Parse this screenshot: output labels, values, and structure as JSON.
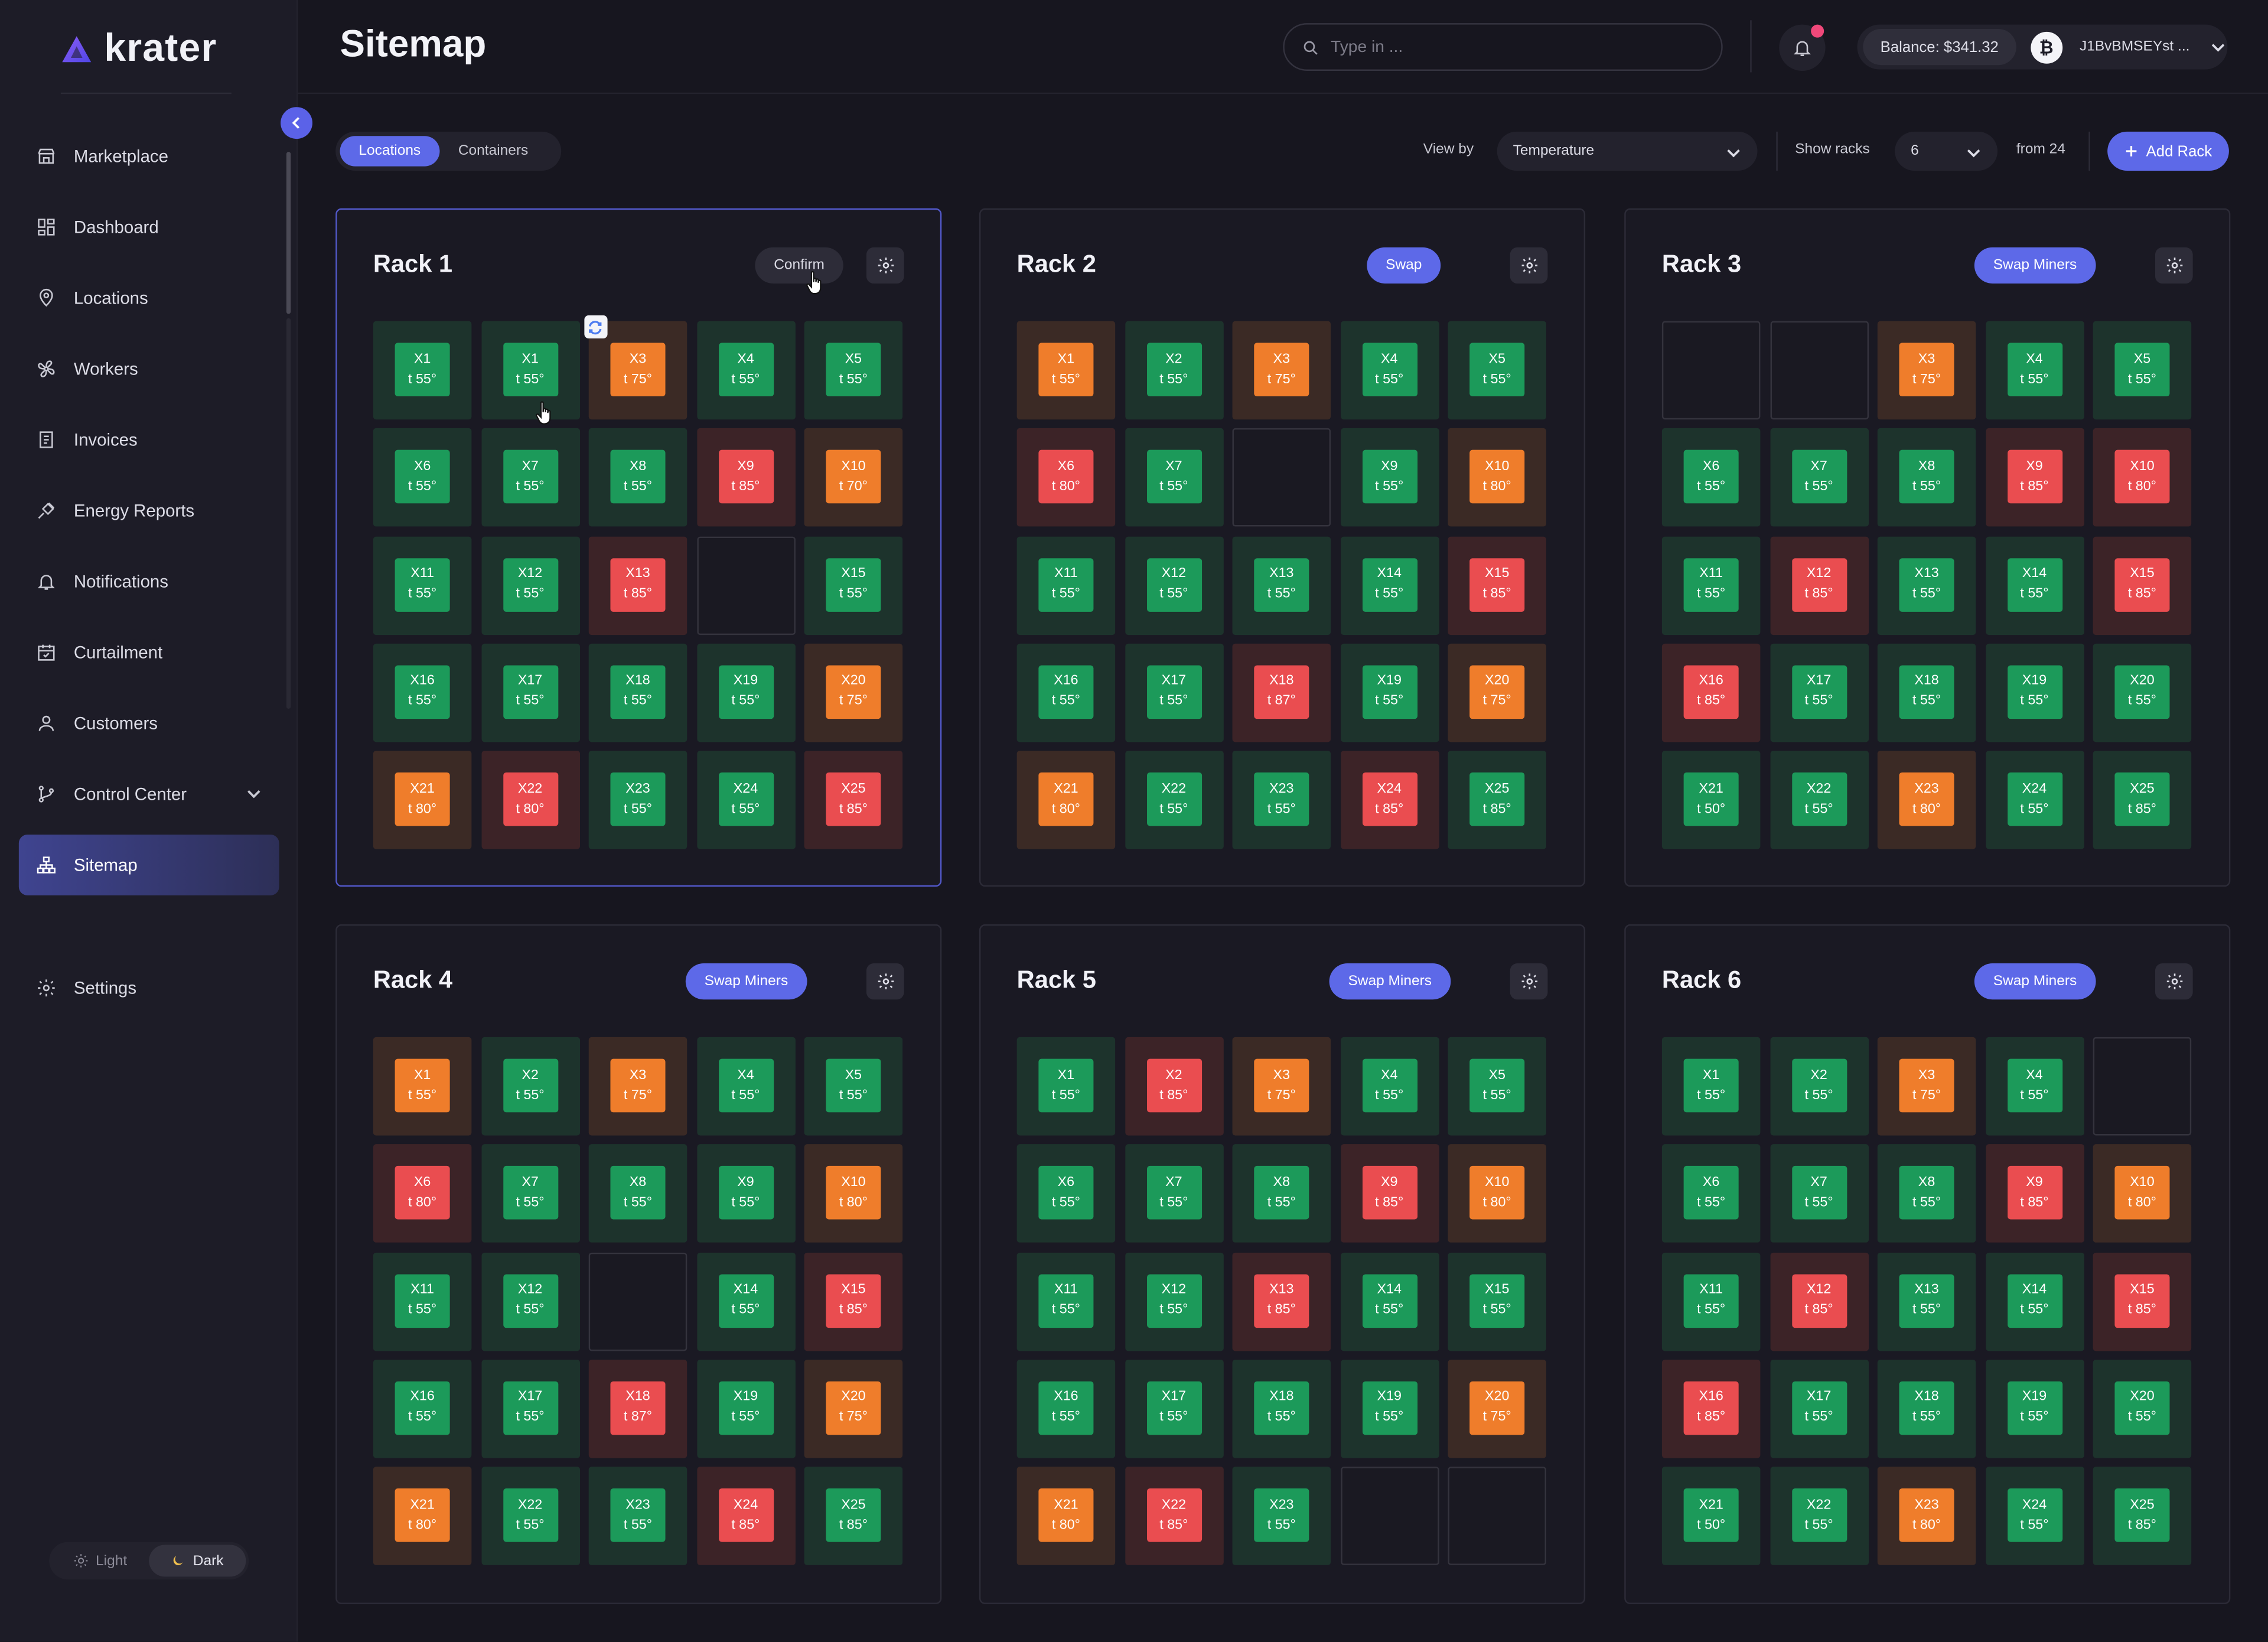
{
  "app": {
    "name": "krater"
  },
  "sidebar": {
    "items": [
      {
        "label": "Marketplace",
        "icon": "storefront-icon"
      },
      {
        "label": "Dashboard",
        "icon": "dashboard-grid-icon"
      },
      {
        "label": "Locations",
        "icon": "map-pin-icon"
      },
      {
        "label": "Workers",
        "icon": "fan-icon"
      },
      {
        "label": "Invoices",
        "icon": "invoice-icon"
      },
      {
        "label": "Energy Reports",
        "icon": "plug-icon"
      },
      {
        "label": "Notifications",
        "icon": "bell-icon"
      },
      {
        "label": "Curtailment",
        "icon": "calendar-check-icon"
      },
      {
        "label": "Customers",
        "icon": "user-icon"
      },
      {
        "label": "Control Center",
        "icon": "git-branch-icon"
      },
      {
        "label": "Sitemap",
        "icon": "sitemap-icon",
        "active": true
      }
    ],
    "settings": {
      "label": "Settings",
      "icon": "gear-icon"
    },
    "theme": {
      "light": "Light",
      "dark": "Dark",
      "selected": "Dark"
    }
  },
  "header": {
    "title": "Sitemap",
    "search_placeholder": "Type in ...",
    "balance": "Balance: $341.32",
    "wallet": "J1BvBMSEYst ...",
    "notification_dot_color": "#f0487a"
  },
  "toolbar": {
    "tabs": [
      "Locations",
      "Containers"
    ],
    "active_tab": "Locations",
    "view_by_label": "View by",
    "view_by_value": "Temperature",
    "show_racks_label": "Show racks",
    "show_racks_value": "6",
    "from_label": "from 24",
    "add_rack": "Add Rack"
  },
  "colors": {
    "accent": "#5d69e8",
    "ok_green": "#1c9a5a",
    "warn_orange": "#ef7d2b",
    "hot_red": "#ea4d50"
  },
  "racks": [
    {
      "name": "Rack 1",
      "action": "Confirm",
      "action_style": "confirm",
      "cells": [
        [
          "X1",
          "t 55°",
          "g"
        ],
        [
          "X1",
          "t 55°",
          "g"
        ],
        [
          "X3",
          "t 75°",
          "o"
        ],
        [
          "X4",
          "t 55°",
          "g"
        ],
        [
          "X5",
          "t 55°",
          "g"
        ],
        [
          "X6",
          "t 55°",
          "g"
        ],
        [
          "X7",
          "t 55°",
          "g"
        ],
        [
          "X8",
          "t 55°",
          "g"
        ],
        [
          "X9",
          "t 85°",
          "r"
        ],
        [
          "X10",
          "t 70°",
          "o"
        ],
        [
          "X11",
          "t 55°",
          "g"
        ],
        [
          "X12",
          "t 55°",
          "g"
        ],
        [
          "X13",
          "t 85°",
          "r"
        ],
        null,
        [
          "X15",
          "t 55°",
          "g"
        ],
        [
          "X16",
          "t 55°",
          "g"
        ],
        [
          "X17",
          "t 55°",
          "g"
        ],
        [
          "X18",
          "t 55°",
          "g"
        ],
        [
          "X19",
          "t 55°",
          "g"
        ],
        [
          "X20",
          "t 75°",
          "o"
        ],
        [
          "X21",
          "t 80°",
          "o"
        ],
        [
          "X22",
          "t 80°",
          "r"
        ],
        [
          "X23",
          "t 55°",
          "g"
        ],
        [
          "X24",
          "t 55°",
          "g"
        ],
        [
          "X25",
          "t 85°",
          "r"
        ]
      ]
    },
    {
      "name": "Rack 2",
      "action": "Swap",
      "action_style": "primary",
      "cells": [
        [
          "X1",
          "t 55°",
          "o"
        ],
        [
          "X2",
          "t 55°",
          "g"
        ],
        [
          "X3",
          "t 75°",
          "o"
        ],
        [
          "X4",
          "t 55°",
          "g"
        ],
        [
          "X5",
          "t 55°",
          "g"
        ],
        [
          "X6",
          "t 80°",
          "r"
        ],
        [
          "X7",
          "t 55°",
          "g"
        ],
        null,
        [
          "X9",
          "t 55°",
          "g"
        ],
        [
          "X10",
          "t 80°",
          "o"
        ],
        [
          "X11",
          "t 55°",
          "g"
        ],
        [
          "X12",
          "t 55°",
          "g"
        ],
        [
          "X13",
          "t 55°",
          "g"
        ],
        [
          "X14",
          "t 55°",
          "g"
        ],
        [
          "X15",
          "t 85°",
          "r"
        ],
        [
          "X16",
          "t 55°",
          "g"
        ],
        [
          "X17",
          "t 55°",
          "g"
        ],
        [
          "X18",
          "t 87°",
          "r"
        ],
        [
          "X19",
          "t 55°",
          "g"
        ],
        [
          "X20",
          "t 75°",
          "o"
        ],
        [
          "X21",
          "t 80°",
          "o"
        ],
        [
          "X22",
          "t 55°",
          "g"
        ],
        [
          "X23",
          "t 55°",
          "g"
        ],
        [
          "X24",
          "t 85°",
          "r"
        ],
        [
          "X25",
          "t 85°",
          "g"
        ]
      ]
    },
    {
      "name": "Rack 3",
      "action": "Swap Miners",
      "action_style": "primary",
      "cells": [
        null,
        null,
        [
          "X3",
          "t 75°",
          "o"
        ],
        [
          "X4",
          "t 55°",
          "g"
        ],
        [
          "X5",
          "t 55°",
          "g"
        ],
        [
          "X6",
          "t 55°",
          "g"
        ],
        [
          "X7",
          "t 55°",
          "g"
        ],
        [
          "X8",
          "t 55°",
          "g"
        ],
        [
          "X9",
          "t 85°",
          "r"
        ],
        [
          "X10",
          "t 80°",
          "r"
        ],
        [
          "X11",
          "t 55°",
          "g"
        ],
        [
          "X12",
          "t 85°",
          "r"
        ],
        [
          "X13",
          "t 55°",
          "g"
        ],
        [
          "X14",
          "t 55°",
          "g"
        ],
        [
          "X15",
          "t 85°",
          "r"
        ],
        [
          "X16",
          "t 85°",
          "r"
        ],
        [
          "X17",
          "t 55°",
          "g"
        ],
        [
          "X18",
          "t 55°",
          "g"
        ],
        [
          "X19",
          "t 55°",
          "g"
        ],
        [
          "X20",
          "t 55°",
          "g"
        ],
        [
          "X21",
          "t 50°",
          "g"
        ],
        [
          "X22",
          "t 55°",
          "g"
        ],
        [
          "X23",
          "t 80°",
          "o"
        ],
        [
          "X24",
          "t 55°",
          "g"
        ],
        [
          "X25",
          "t 85°",
          "g"
        ]
      ]
    },
    {
      "name": "Rack 4",
      "action": "Swap Miners",
      "action_style": "primary",
      "cells": [
        [
          "X1",
          "t 55°",
          "o"
        ],
        [
          "X2",
          "t 55°",
          "g"
        ],
        [
          "X3",
          "t 75°",
          "o"
        ],
        [
          "X4",
          "t 55°",
          "g"
        ],
        [
          "X5",
          "t 55°",
          "g"
        ],
        [
          "X6",
          "t 80°",
          "r"
        ],
        [
          "X7",
          "t 55°",
          "g"
        ],
        [
          "X8",
          "t 55°",
          "g"
        ],
        [
          "X9",
          "t 55°",
          "g"
        ],
        [
          "X10",
          "t 80°",
          "o"
        ],
        [
          "X11",
          "t 55°",
          "g"
        ],
        [
          "X12",
          "t 55°",
          "g"
        ],
        null,
        [
          "X14",
          "t 55°",
          "g"
        ],
        [
          "X15",
          "t 85°",
          "r"
        ],
        [
          "X16",
          "t 55°",
          "g"
        ],
        [
          "X17",
          "t 55°",
          "g"
        ],
        [
          "X18",
          "t 87°",
          "r"
        ],
        [
          "X19",
          "t 55°",
          "g"
        ],
        [
          "X20",
          "t 75°",
          "o"
        ],
        [
          "X21",
          "t 80°",
          "o"
        ],
        [
          "X22",
          "t 55°",
          "g"
        ],
        [
          "X23",
          "t 55°",
          "g"
        ],
        [
          "X24",
          "t 85°",
          "r"
        ],
        [
          "X25",
          "t 85°",
          "g"
        ]
      ]
    },
    {
      "name": "Rack 5",
      "action": "Swap Miners",
      "action_style": "primary",
      "cells": [
        [
          "X1",
          "t 55°",
          "g"
        ],
        [
          "X2",
          "t 85°",
          "r"
        ],
        [
          "X3",
          "t 75°",
          "o"
        ],
        [
          "X4",
          "t 55°",
          "g"
        ],
        [
          "X5",
          "t 55°",
          "g"
        ],
        [
          "X6",
          "t 55°",
          "g"
        ],
        [
          "X7",
          "t 55°",
          "g"
        ],
        [
          "X8",
          "t 55°",
          "g"
        ],
        [
          "X9",
          "t 85°",
          "r"
        ],
        [
          "X10",
          "t 80°",
          "o"
        ],
        [
          "X11",
          "t 55°",
          "g"
        ],
        [
          "X12",
          "t 55°",
          "g"
        ],
        [
          "X13",
          "t 85°",
          "r"
        ],
        [
          "X14",
          "t 55°",
          "g"
        ],
        [
          "X15",
          "t 55°",
          "g"
        ],
        [
          "X16",
          "t 55°",
          "g"
        ],
        [
          "X17",
          "t 55°",
          "g"
        ],
        [
          "X18",
          "t 55°",
          "g"
        ],
        [
          "X19",
          "t 55°",
          "g"
        ],
        [
          "X20",
          "t 75°",
          "o"
        ],
        [
          "X21",
          "t 80°",
          "o"
        ],
        [
          "X22",
          "t 85°",
          "r"
        ],
        [
          "X23",
          "t 55°",
          "g"
        ],
        null,
        null
      ]
    },
    {
      "name": "Rack 6",
      "action": "Swap Miners",
      "action_style": "primary",
      "cells": [
        [
          "X1",
          "t 55°",
          "g"
        ],
        [
          "X2",
          "t 55°",
          "g"
        ],
        [
          "X3",
          "t 75°",
          "o"
        ],
        [
          "X4",
          "t 55°",
          "g"
        ],
        null,
        [
          "X6",
          "t 55°",
          "g"
        ],
        [
          "X7",
          "t 55°",
          "g"
        ],
        [
          "X8",
          "t 55°",
          "g"
        ],
        [
          "X9",
          "t 85°",
          "r"
        ],
        [
          "X10",
          "t 80°",
          "o"
        ],
        [
          "X11",
          "t 55°",
          "g"
        ],
        [
          "X12",
          "t 85°",
          "r"
        ],
        [
          "X13",
          "t 55°",
          "g"
        ],
        [
          "X14",
          "t 55°",
          "g"
        ],
        [
          "X15",
          "t 85°",
          "r"
        ],
        [
          "X16",
          "t 85°",
          "r"
        ],
        [
          "X17",
          "t 55°",
          "g"
        ],
        [
          "X18",
          "t 55°",
          "g"
        ],
        [
          "X19",
          "t 55°",
          "g"
        ],
        [
          "X20",
          "t 55°",
          "g"
        ],
        [
          "X21",
          "t 50°",
          "g"
        ],
        [
          "X22",
          "t 55°",
          "g"
        ],
        [
          "X23",
          "t 80°",
          "o"
        ],
        [
          "X24",
          "t 55°",
          "g"
        ],
        [
          "X25",
          "t 85°",
          "g"
        ]
      ]
    }
  ]
}
